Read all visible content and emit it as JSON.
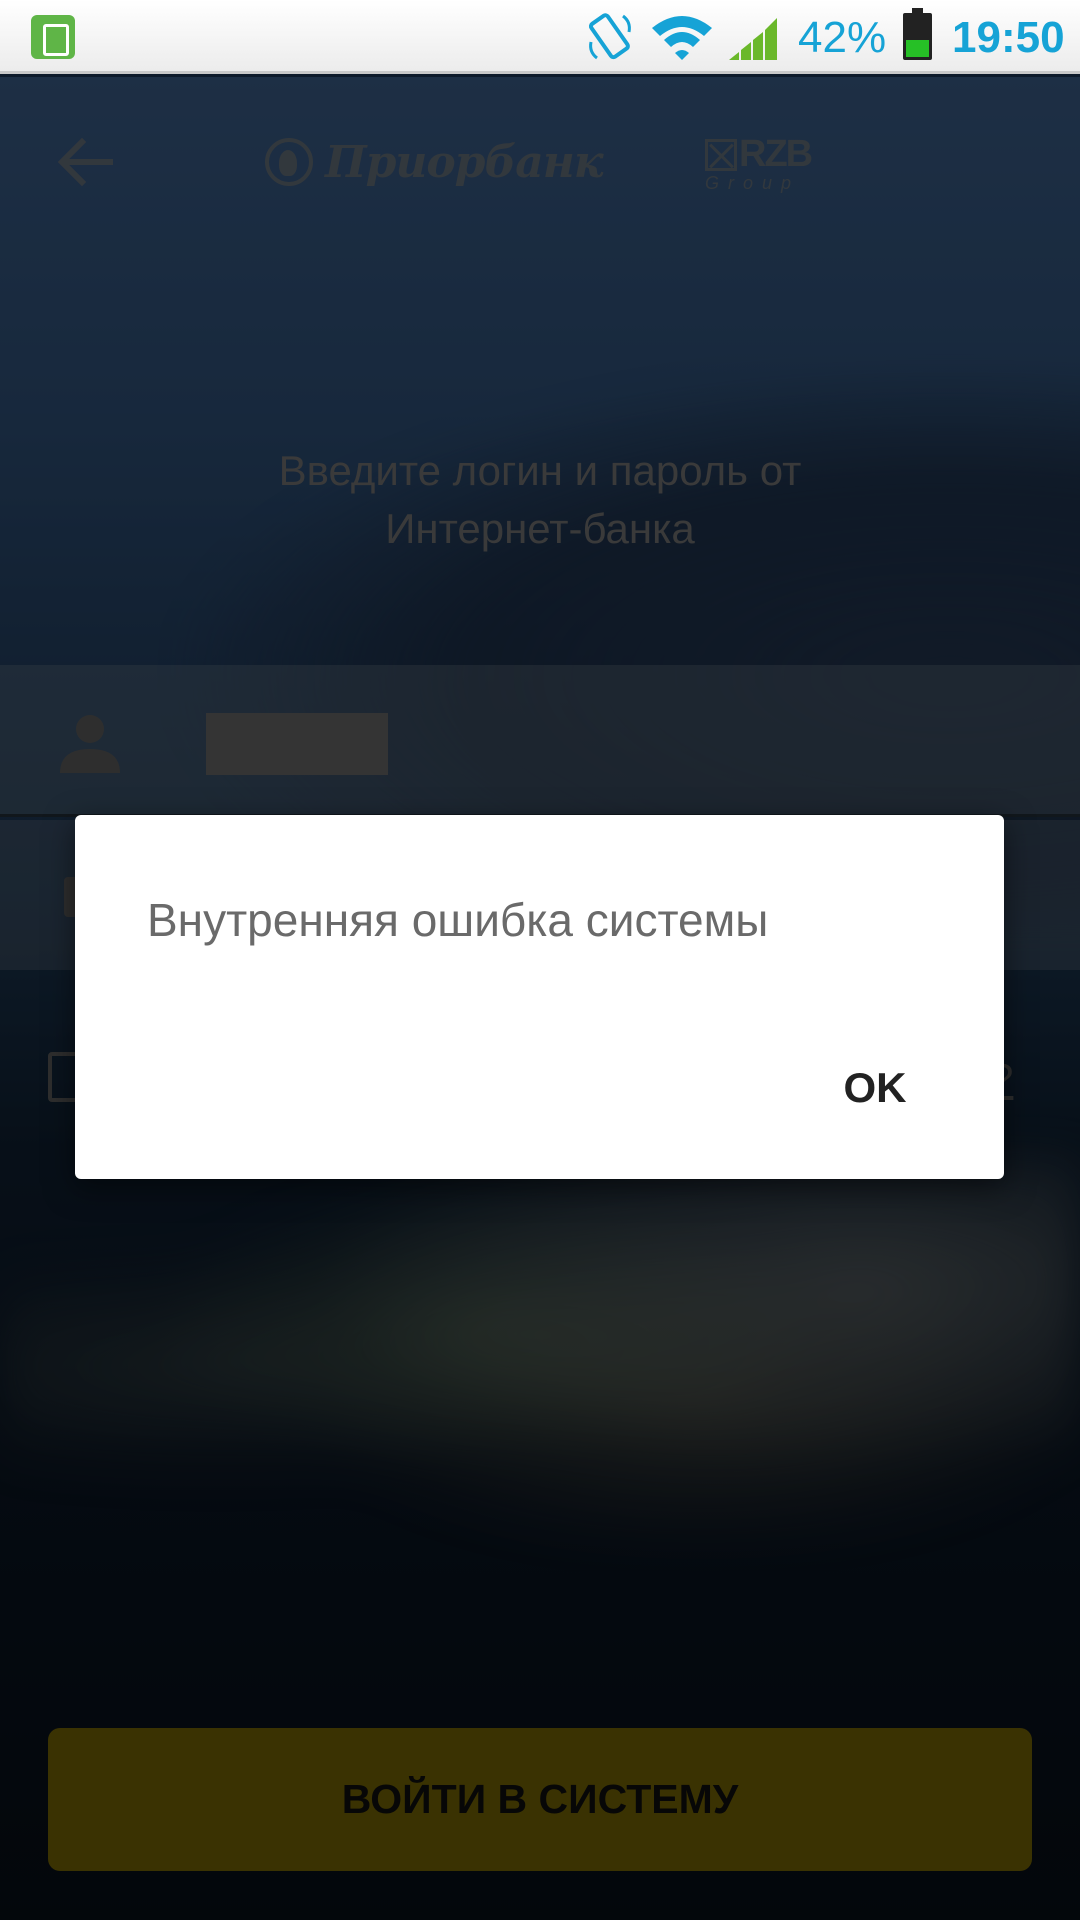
{
  "status_bar": {
    "battery_percent": "42%",
    "battery_level": 0.42,
    "time": "19:50",
    "accent_color": "#16a3d6",
    "icons": [
      "screenshot-app-icon",
      "rotate-icon",
      "wifi-icon",
      "signal-icon",
      "battery-icon"
    ]
  },
  "header": {
    "back_icon": "arrow-left-icon",
    "bank_name": "Приорбанк",
    "group_logo": "RZB",
    "group_logo_sub": "Group"
  },
  "login": {
    "prompt_line1": "Введите логин и пароль от",
    "prompt_line2": "Интернет-банка",
    "username_icon": "person-icon",
    "password_icon": "lock-icon",
    "submit_label": "ВОЙТИ В СИСТЕМУ",
    "submit_color": "#6a5b04"
  },
  "dialog": {
    "message": "Внутренняя ошибка системы",
    "ok_label": "OK"
  }
}
